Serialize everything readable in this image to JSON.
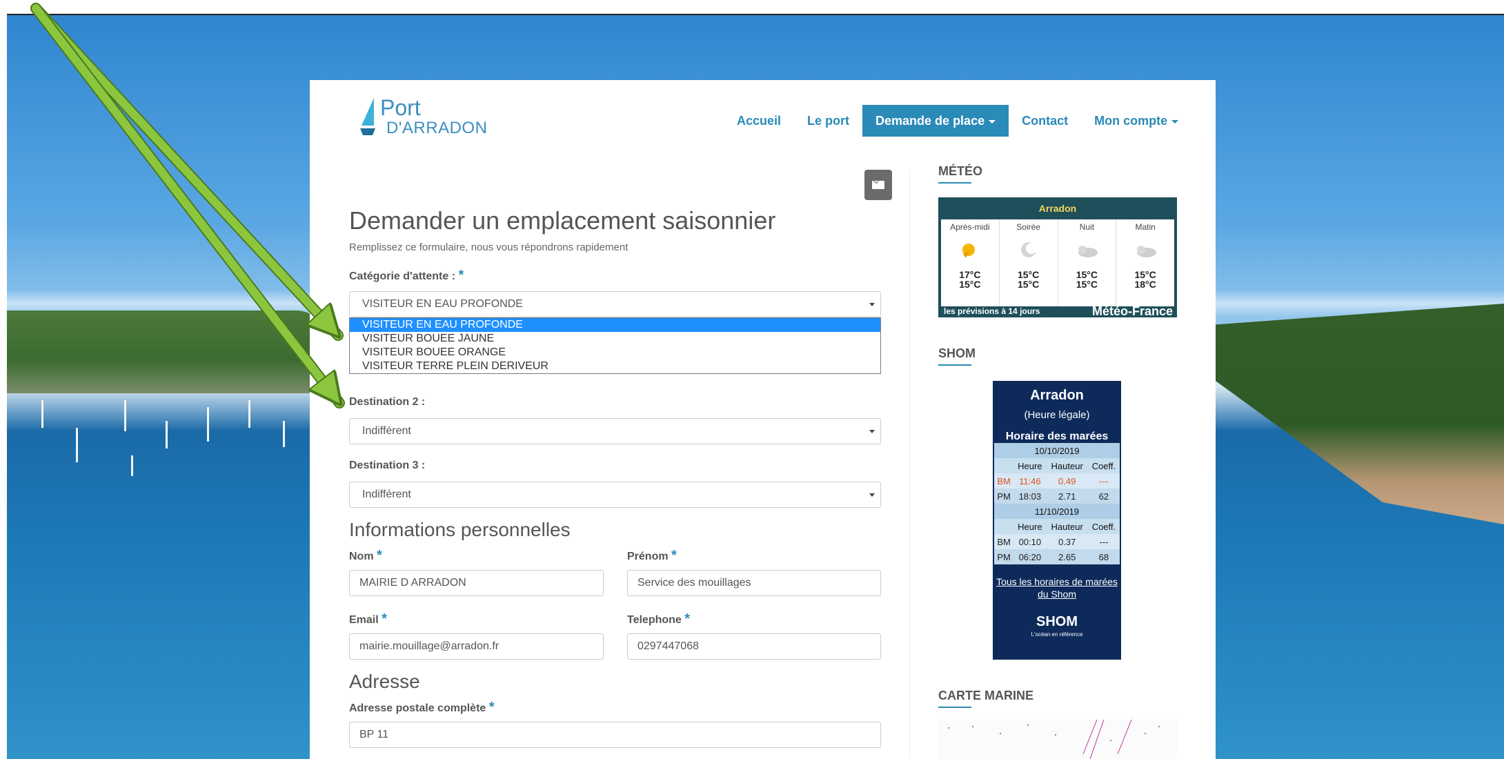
{
  "brand": {
    "line1": "Port",
    "line2": "D'ARRADON",
    "color": "#3b8fc2"
  },
  "nav": {
    "items": [
      {
        "label": "Accueil"
      },
      {
        "label": "Le port"
      },
      {
        "label": "Demande de place"
      },
      {
        "label": "Contact"
      },
      {
        "label": "Mon compte"
      }
    ],
    "accent": "#2a8ab8"
  },
  "form": {
    "title": "Demander un emplacement saisonnier",
    "subtitle": "Remplissez ce formulaire, nous vous répondrons rapidement",
    "category_label": "Catégorie d'attente :",
    "category_value": "VISITEUR EN EAU PROFONDE",
    "category_options": [
      "VISITEUR EN EAU PROFONDE",
      "VISITEUR BOUEE JAUNE",
      "VISITEUR BOUEE ORANGE",
      "VISITEUR TERRE PLEIN DERIVEUR"
    ],
    "dest2_label": "Destination 2 :",
    "dest2_value": "Indifférent",
    "dest3_label": "Destination 3 :",
    "dest3_value": "Indifférent",
    "section_personal": "Informations personnelles",
    "nom_label": "Nom",
    "nom_value": "MAIRIE D ARRADON",
    "prenom_label": "Prénom",
    "prenom_value": "Service des mouillages",
    "email_label": "Email",
    "email_value": "mairie.mouillage@arradon.fr",
    "tel_label": "Telephone",
    "tel_value": "0297447068",
    "section_address": "Adresse",
    "address_label": "Adresse postale complète",
    "address_value": "BP 11",
    "required_mark": "*"
  },
  "sidebar": {
    "meteo_title": "MÉTÉO",
    "meteo": {
      "city": "Arradon",
      "periods": [
        {
          "name": "Après-midi",
          "icon": "sun-cloud-icon",
          "t1": "17°C",
          "t2": "15°C"
        },
        {
          "name": "Soirée",
          "icon": "moon-cloud-icon",
          "t1": "15°C",
          "t2": "15°C"
        },
        {
          "name": "Nuit",
          "icon": "cloud-icon",
          "t1": "15°C",
          "t2": "15°C"
        },
        {
          "name": "Matin",
          "icon": "cloud-icon",
          "t1": "15°C",
          "t2": "18°C"
        }
      ],
      "link": "les prévisions à 14 jours",
      "provider": "Météo-France"
    },
    "shom_title": "SHOM",
    "shom": {
      "city": "Arradon",
      "sub": "(Heure légale)",
      "title": "Horaire des marées",
      "days": [
        {
          "date": "10/10/2019",
          "header": [
            "",
            "Heure",
            "Hauteur",
            "Coeff."
          ],
          "rows": [
            [
              "BM",
              "11:46",
              "0.49",
              "---"
            ],
            [
              "PM",
              "18:03",
              "2.71",
              "62"
            ]
          ]
        },
        {
          "date": "11/10/2019",
          "header": [
            "",
            "Heure",
            "Hauteur",
            "Coeff."
          ],
          "rows": [
            [
              "BM",
              "00:10",
              "0.37",
              "---"
            ],
            [
              "PM",
              "06:20",
              "2.65",
              "68"
            ]
          ]
        }
      ],
      "link": "Tous les horaires de marées du Shom",
      "brand": "SHOM",
      "tagline": "L'océan en référence"
    },
    "carte_title": "CARTE MARINE"
  }
}
